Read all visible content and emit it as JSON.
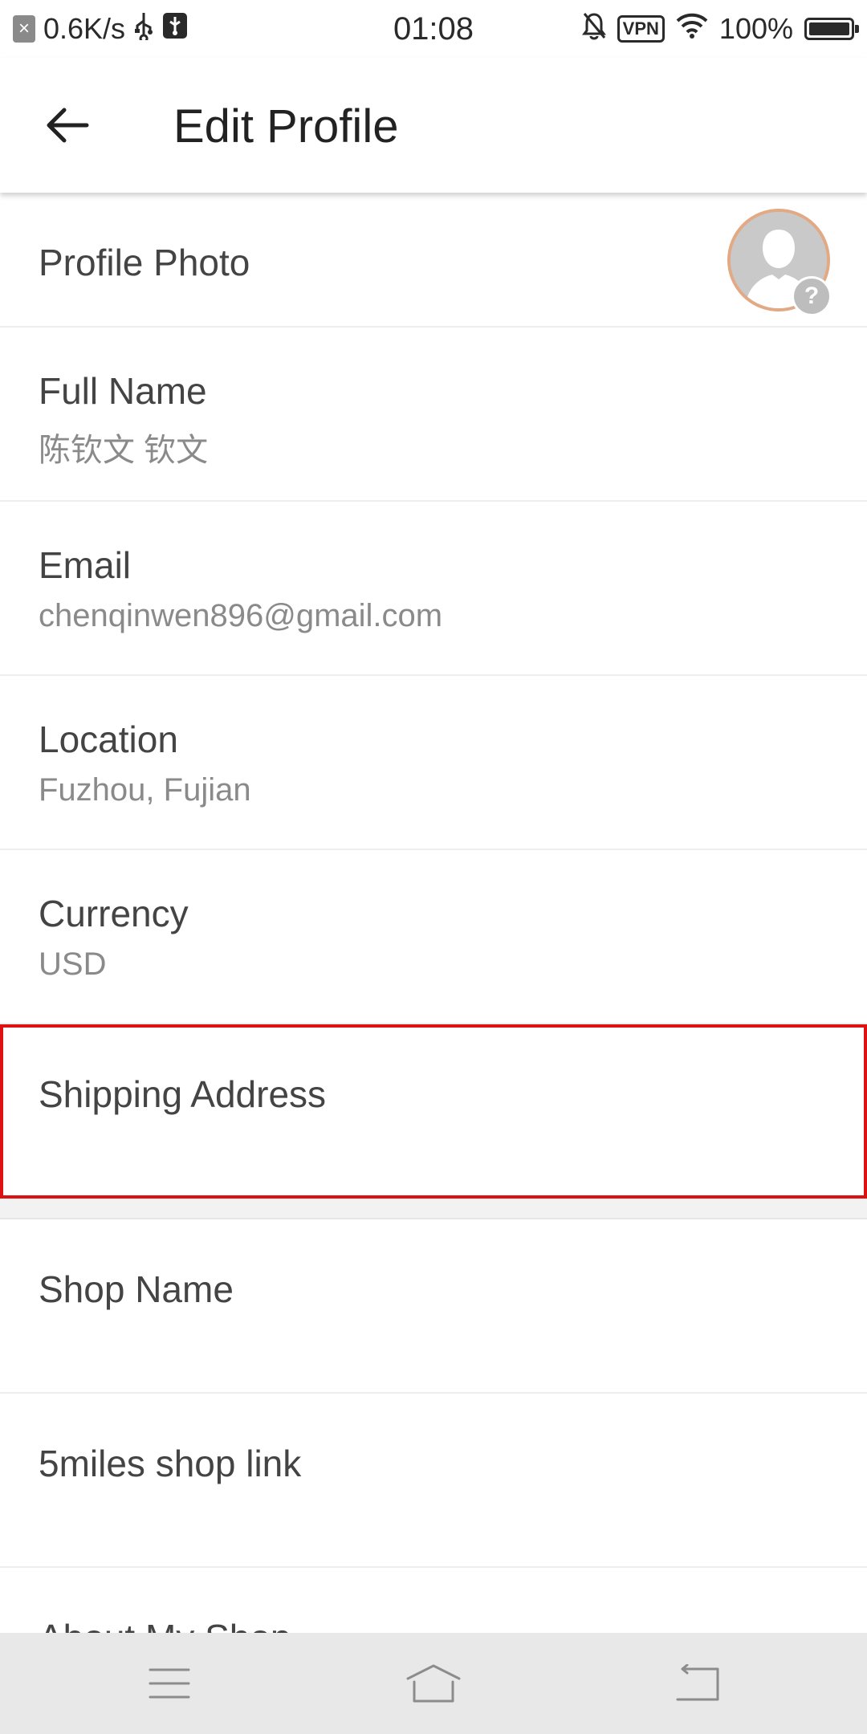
{
  "status_bar": {
    "net_speed": "0.6K/s",
    "time": "01:08",
    "vpn_label": "VPN",
    "battery_percent": "100%",
    "icons": [
      "notification-icon",
      "usb-icon",
      "usb-debug-icon",
      "bell-off-icon",
      "vpn-icon",
      "wifi-icon",
      "battery-icon"
    ]
  },
  "header": {
    "title": "Edit Profile",
    "back_icon": "arrow-left-icon"
  },
  "profile": {
    "photo_label": "Profile Photo",
    "avatar_badge": "?"
  },
  "fields": [
    {
      "label": "Full Name",
      "value": "陈钦文 钦文"
    },
    {
      "label": "Email",
      "value": "chenqinwen896@gmail.com"
    },
    {
      "label": "Location",
      "value": "Fuzhou, Fujian"
    },
    {
      "label": "Currency",
      "value": "USD"
    },
    {
      "label": "Shipping Address",
      "value": ""
    }
  ],
  "shop_fields": [
    {
      "label": "Shop Name",
      "value": ""
    },
    {
      "label": "5miles shop link",
      "value": ""
    },
    {
      "label": "About My Shop",
      "value": ""
    }
  ],
  "colors": {
    "highlight": "#dd1111",
    "avatar_ring": "#e2a985",
    "nav_bar_bg": "#e8e8e8"
  },
  "nav_bar": {
    "icons": [
      "menu-icon",
      "home-icon",
      "back-icon"
    ]
  }
}
